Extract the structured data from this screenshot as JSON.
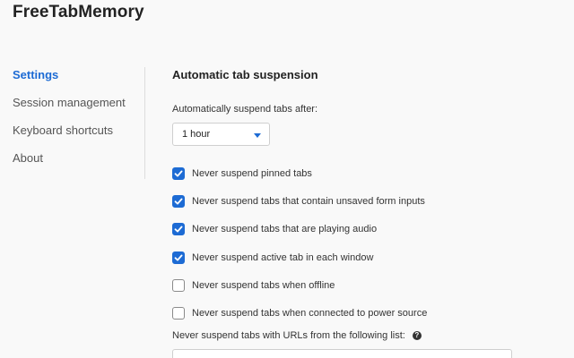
{
  "app": {
    "title": "FreeTabMemory"
  },
  "sidebar": {
    "items": [
      {
        "label": "Settings",
        "active": true
      },
      {
        "label": "Session management",
        "active": false
      },
      {
        "label": "Keyboard shortcuts",
        "active": false
      },
      {
        "label": "About",
        "active": false
      }
    ]
  },
  "main": {
    "section_title": "Automatic tab suspension",
    "suspend_after_label": "Automatically suspend tabs after:",
    "suspend_after_select": {
      "value": "1 hour",
      "icon": "chevron-down-icon"
    },
    "options": [
      {
        "label": "Never suspend pinned tabs",
        "checked": true
      },
      {
        "label": "Never suspend tabs that contain unsaved form inputs",
        "checked": true
      },
      {
        "label": "Never suspend tabs that are playing audio",
        "checked": true
      },
      {
        "label": "Never suspend active tab in each window",
        "checked": true
      },
      {
        "label": "Never suspend tabs when offline",
        "checked": false
      },
      {
        "label": "Never suspend tabs when connected to power source",
        "checked": false
      }
    ],
    "url_list_label": "Never suspend tabs with URLs from the following list:",
    "url_list_help_icon": "question-circle-icon",
    "url_list_help_glyph": "?",
    "url_list_value": ""
  },
  "colors": {
    "accent": "#1d6bd4",
    "background": "#f9f9f9",
    "text": "#333333",
    "divider": "#dddddd"
  }
}
